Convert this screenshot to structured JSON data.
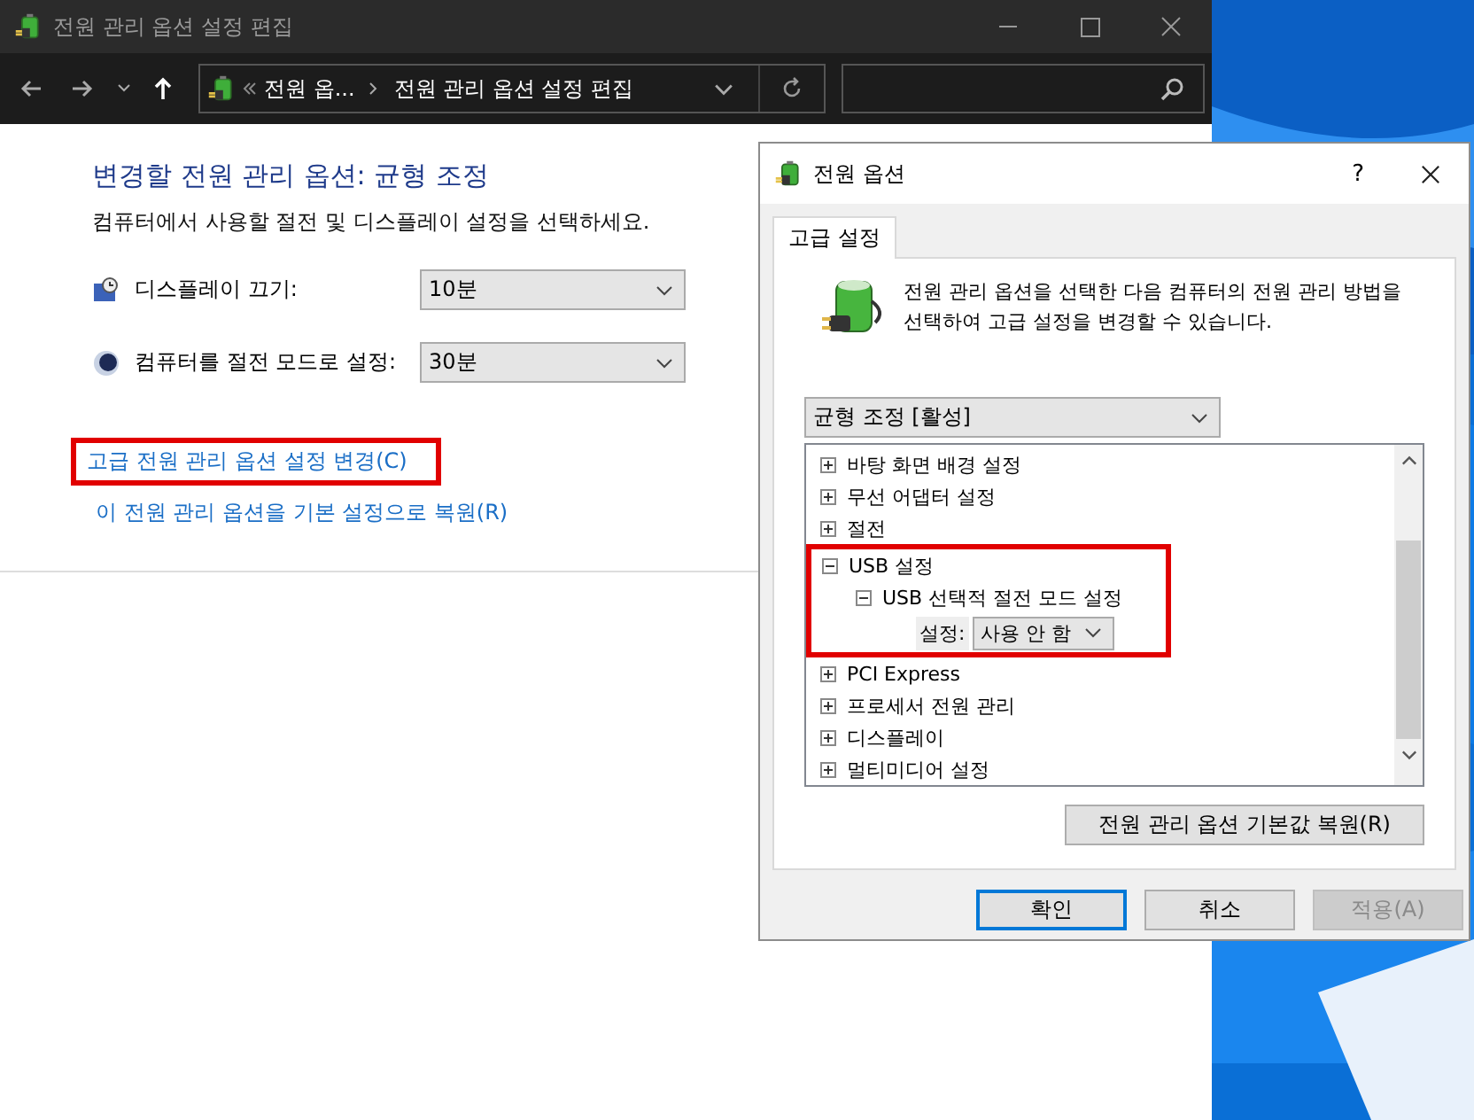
{
  "main_window": {
    "title": "전원 관리 옵션 설정 편집",
    "address": {
      "crumbs": [
        "전원 옵...",
        "전원 관리 옵션 설정 편집"
      ]
    },
    "heading": "변경할 전원 관리 옵션: 균형 조정",
    "description": "컴퓨터에서 사용할 절전 및 디스플레이 설정을 선택하세요.",
    "settings": [
      {
        "kind": "display",
        "label": "디스플레이 끄기:",
        "value": "10분"
      },
      {
        "kind": "sleep",
        "label": "컴퓨터를 절전 모드로 설정:",
        "value": "30분"
      }
    ],
    "links": [
      {
        "text": "고급 전원 관리 옵션 설정 변경(C)",
        "highlighted": true
      },
      {
        "text": "이 전원 관리 옵션을 기본 설정으로 복원(R)",
        "highlighted": false
      }
    ]
  },
  "dialog": {
    "title": "전원 옵션",
    "help": "?",
    "tabs": [
      {
        "label": "고급 설정",
        "selected": true
      }
    ],
    "intro": "전원 관리 옵션을 선택한 다음 컴퓨터의 전원 관리 방법을 선택하여 고급 설정을 변경할 수 있습니다.",
    "plan": "균형 조정 [활성]",
    "tree": [
      {
        "label": "바탕 화면 배경 설정",
        "expanded": false,
        "highlighted": false
      },
      {
        "label": "무선 어댑터 설정",
        "expanded": false,
        "highlighted": false
      },
      {
        "label": "절전",
        "expanded": false,
        "highlighted": false
      },
      {
        "label": "USB 설정",
        "expanded": true,
        "highlighted": true,
        "children": [
          {
            "label": "USB 선택적 절전 모드 설정",
            "expanded": true,
            "highlighted": false,
            "setting": {
              "label": "설정:",
              "value": "사용 안 함"
            }
          }
        ]
      },
      {
        "label": "PCI Express",
        "expanded": false,
        "highlighted": false
      },
      {
        "label": "프로세서 전원 관리",
        "expanded": false,
        "highlighted": false
      },
      {
        "label": "디스플레이",
        "expanded": false,
        "highlighted": false
      },
      {
        "label": "멀티미디어 설정",
        "expanded": false,
        "highlighted": false
      }
    ],
    "restore_button": "전원 관리 옵션 기본값 복원(R)",
    "buttons": [
      {
        "label": "확인",
        "kind": "default",
        "disabled": false
      },
      {
        "label": "취소",
        "kind": "normal",
        "disabled": false
      },
      {
        "label": "적용(A)",
        "kind": "normal",
        "disabled": true
      }
    ]
  }
}
